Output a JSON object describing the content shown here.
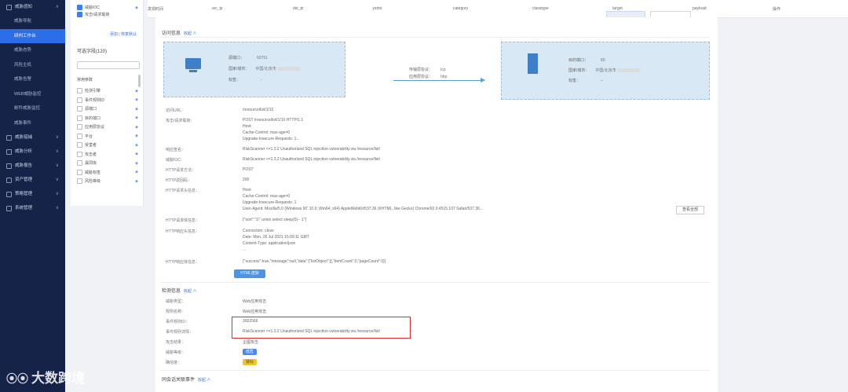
{
  "sidebar": {
    "items": [
      {
        "label": "威胁感知",
        "type": "group",
        "chev": "∧"
      },
      {
        "label": "威胁导航",
        "type": "sub"
      },
      {
        "label": "研判工作台",
        "type": "sub",
        "active": true
      },
      {
        "label": "威胁态势",
        "type": "sub"
      },
      {
        "label": "风险主机",
        "type": "sub"
      },
      {
        "label": "威胁告警",
        "type": "sub"
      },
      {
        "label": "WEB威胁监控",
        "type": "sub"
      },
      {
        "label": "邮件威胁监控",
        "type": "sub"
      },
      {
        "label": "威胁事件",
        "type": "sub"
      },
      {
        "label": "威胁猎捕",
        "type": "group",
        "chev": "∨"
      },
      {
        "label": "威胁分析",
        "type": "group",
        "chev": "∨"
      },
      {
        "label": "威胁报告",
        "type": "group",
        "chev": "∨"
      },
      {
        "label": "资产管理",
        "type": "group",
        "chev": "∨"
      },
      {
        "label": "策略管理",
        "type": "group",
        "chev": "∨"
      },
      {
        "label": "系统管理",
        "type": "group",
        "chev": "∨"
      }
    ]
  },
  "filter": {
    "top_checks": [
      {
        "label": "威胁IOC",
        "checked": true
      },
      {
        "label": "攻击/请求载荷",
        "checked": true
      }
    ],
    "link_hint": "添加",
    "link_reset": "恢复默认",
    "fields_title": "可选字段(120)",
    "common_label": "常用参数",
    "fields": [
      "检测引擎",
      "事件规则ID",
      "源端口",
      "目的端口",
      "应用层协议",
      "平台",
      "受害者",
      "攻击者",
      "漏洞库",
      "威胁标签",
      "风险等级"
    ]
  },
  "table_header": {
    "cols": [
      "发现时间",
      "src_ip",
      "dst_ip",
      "proto",
      "category",
      "classtype",
      "target",
      "payload",
      "操作"
    ]
  },
  "access": {
    "title": "访问信息",
    "fold": "收起 ∧",
    "src": {
      "k1": "源端口：",
      "v1": "60751",
      "k2": "国家/城市：",
      "v2": "中国/北京市",
      "k3": "标签：",
      "v3": "-"
    },
    "proto_k1": "传输层协议：",
    "proto_v1": "tcp",
    "proto_k2": "应用层协议：",
    "proto_v2": "http",
    "dst": {
      "k1": "目的端口：",
      "v1": "80",
      "k2": "国家/城市：",
      "v2": "中国/北京市",
      "k3": "标签：",
      "v3": "--"
    }
  },
  "detail_rows": [
    {
      "k": "访问URL：",
      "v": "/resource/list/1/10"
    },
    {
      "k": "攻击/请求载荷：",
      "v": "POST /resource/list/1/10 HTTP/1.1"
    },
    {
      "k": "",
      "v": "Host: "
    },
    {
      "k": "",
      "v": "Cache-Control: max-age=0"
    },
    {
      "k": "",
      "v": "Upgrade-Insecure-Requests: 1..."
    },
    {
      "k": "响应签名：",
      "v": "RiskScanner <=1.3.2 Unauthorized SQL injection vulnerability.via /resource/list/"
    },
    {
      "k": "威胁IOC：",
      "v": "RiskScanner <=1.3.2 Unauthorized SQL injection vulnerability.via /resource/list/"
    },
    {
      "k": "HTTP请求方法：",
      "v": "POST"
    },
    {
      "k": "HTTP返回码：",
      "v": "200"
    },
    {
      "k": "HTTP请求头信息：",
      "v": "Host: "
    },
    {
      "k": "",
      "v": "Cache-Control: max-age=0"
    },
    {
      "k": "",
      "v": "Upgrade-Insecure-Requests: 1"
    },
    {
      "k": "",
      "v": "User-Agent: Mozilla/5.0 (Windows NT 10.0; Win64; x64) AppleWebKit/537.36 (KHTML, like Gecko) Chrome/92.0.4515.107 Safari/537.36..."
    },
    {
      "k": "HTTP请求体信息：",
      "v": "{\"sort\":\"1\\\" union select sleep(5)-- 1\"}"
    },
    {
      "k": "HTTP响应头信息：",
      "v": "Connection: close"
    },
    {
      "k": "",
      "v": "Date: Mon, 26 Jul 2021 15:09:11 GMT"
    },
    {
      "k": "",
      "v": "Content-Type: application/json"
    },
    {
      "k": "",
      "v": "..."
    },
    {
      "k": "HTTP响应体信息：",
      "v": "{\"success\":true,\"message\":null,\"data\":{\"listObject\":[],\"itemCount\":0,\"pageCount\":0}}"
    }
  ],
  "view_all_btn": "查看全部",
  "html_btn": "HTML渲染",
  "detect": {
    "title": "检测信息",
    "fold": "收起 ∧",
    "rows": [
      {
        "k": "威胁类型：",
        "v": "Web应用攻击"
      },
      {
        "k": "规则名称：",
        "v": "Web应用攻击"
      },
      {
        "k": "事件规则ID：",
        "v": "3002569"
      },
      {
        "k": "事件规则详情：",
        "v": "RiskScanner <=1.3.2 Unauthorized SQL injection vulnerability.via /resource/list/"
      },
      {
        "k": "攻击结果：",
        "v": "企图攻击"
      },
      {
        "k": "威胁等级：",
        "v": "低危"
      },
      {
        "k": "确信度：",
        "v": "疑似"
      }
    ],
    "colors": {
      "low": "#4b8ae8",
      "maybe": "#f0c330",
      "highlight": "#d9302e"
    }
  },
  "related": {
    "title": "同会话关联事件",
    "fold": "收起 ∧"
  },
  "watermark": "大数跨境"
}
